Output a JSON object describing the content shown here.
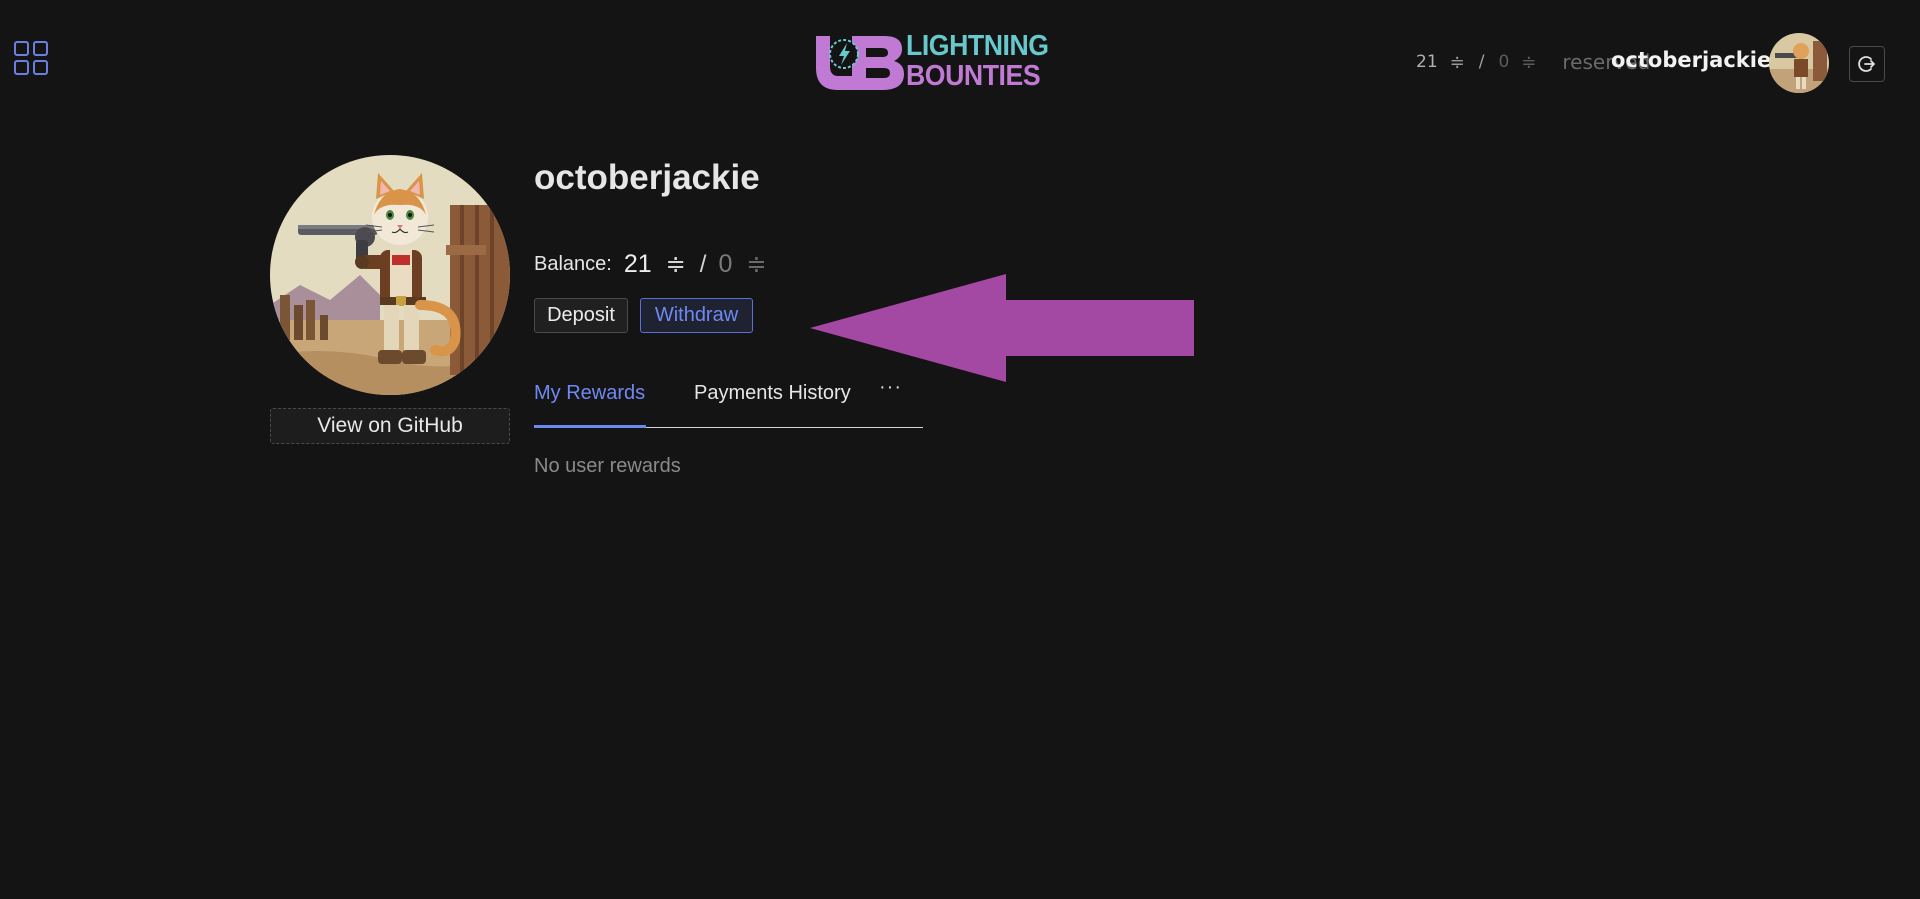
{
  "header": {
    "logo": {
      "line1": "LIGHTNING",
      "line2": "BOUNTIES",
      "mark_text": "LB",
      "colors": {
        "teal": "#68c9cc",
        "purple": "#c17ad4"
      }
    },
    "balance": {
      "available": "21",
      "reserved_amount": "0",
      "separator": "/",
      "reserved_label": "reserved",
      "unit_icon": "sats-icon"
    },
    "username": "octoberjackie",
    "icons": {
      "apps": "grid-icon",
      "logout": "logout-icon"
    }
  },
  "profile": {
    "username": "octoberjackie",
    "avatar": "cowboy-cat-avatar",
    "github_button": "View on GitHub",
    "balance_label": "Balance:",
    "balance_available": "21",
    "balance_separator": "/",
    "balance_reserved": "0",
    "deposit_label": "Deposit",
    "withdraw_label": "Withdraw"
  },
  "tabs": [
    {
      "label": "My Rewards",
      "active": true
    },
    {
      "label": "Payments History",
      "active": false
    },
    {
      "label": "···",
      "active": false
    }
  ],
  "rewards": {
    "empty_message": "No user rewards"
  },
  "annotation": {
    "type": "arrow-pointing-left",
    "color": "#a349a4"
  },
  "theme": {
    "background": "#151415",
    "accent": "#6f89f2"
  }
}
